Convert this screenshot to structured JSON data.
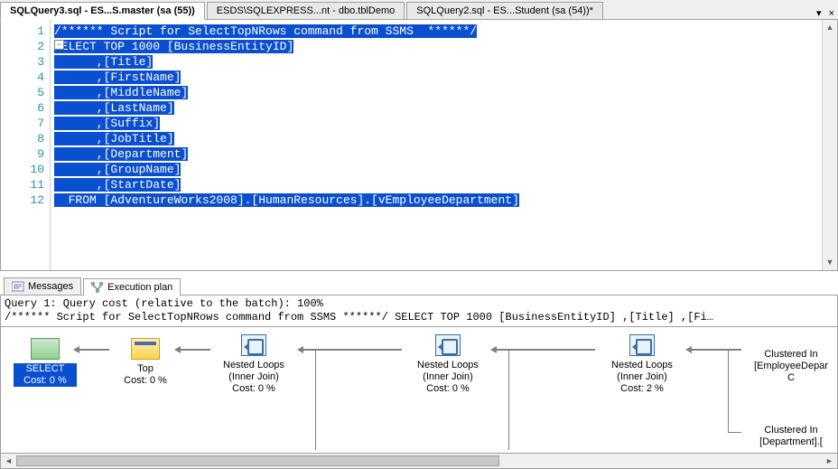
{
  "tabs": [
    {
      "label": "SQLQuery3.sql - ES...S.master (sa (55))",
      "active": true
    },
    {
      "label": "ESDS\\SQLEXPRESS...nt - dbo.tblDemo",
      "active": false
    },
    {
      "label": "SQLQuery2.sql - ES...Student (sa (54))*",
      "active": false
    }
  ],
  "tab_controls": {
    "dropdown": "▾",
    "close": "×"
  },
  "code": {
    "lines": [
      "/****** Script for SelectTopNRows command from SSMS  ******/",
      "SELECT TOP 1000 [BusinessEntityID]",
      "      ,[Title]",
      "      ,[FirstName]",
      "      ,[MiddleName]",
      "      ,[LastName]",
      "      ,[Suffix]",
      "      ,[JobTitle]",
      "      ,[Department]",
      "      ,[GroupName]",
      "      ,[StartDate]",
      "  FROM [AdventureWorks2008].[HumanResources].[vEmployeeDepartment]"
    ],
    "fold_glyph": "−"
  },
  "scroll": {
    "up": "▲",
    "down": "▼",
    "left": "◄",
    "right": "►"
  },
  "result_tabs": [
    {
      "label": "Messages",
      "active": false
    },
    {
      "label": "Execution plan",
      "active": true
    }
  ],
  "plan": {
    "header_line1": "Query 1: Query cost (relative to the batch): 100%",
    "header_line2": "/****** Script for SelectTopNRows command from SSMS ******/ SELECT TOP 1000 [BusinessEntityID] ,[Title] ,[Fi…",
    "nodes": {
      "select": {
        "title": "SELECT",
        "cost": "Cost: 0 %"
      },
      "top": {
        "title": "Top",
        "cost": "Cost: 0 %"
      },
      "nl1": {
        "title": "Nested Loops",
        "sub": "(Inner Join)",
        "cost": "Cost: 0 %"
      },
      "nl2": {
        "title": "Nested Loops",
        "sub": "(Inner Join)",
        "cost": "Cost: 0 %"
      },
      "nl3": {
        "title": "Nested Loops",
        "sub": "(Inner Join)",
        "cost": "Cost: 2 %"
      },
      "clust1": {
        "title": "Clustered In",
        "sub": "[EmployeeDepar",
        "sub2": "C"
      },
      "clust2": {
        "title": "Clustered In",
        "sub": "[Department].["
      }
    }
  }
}
